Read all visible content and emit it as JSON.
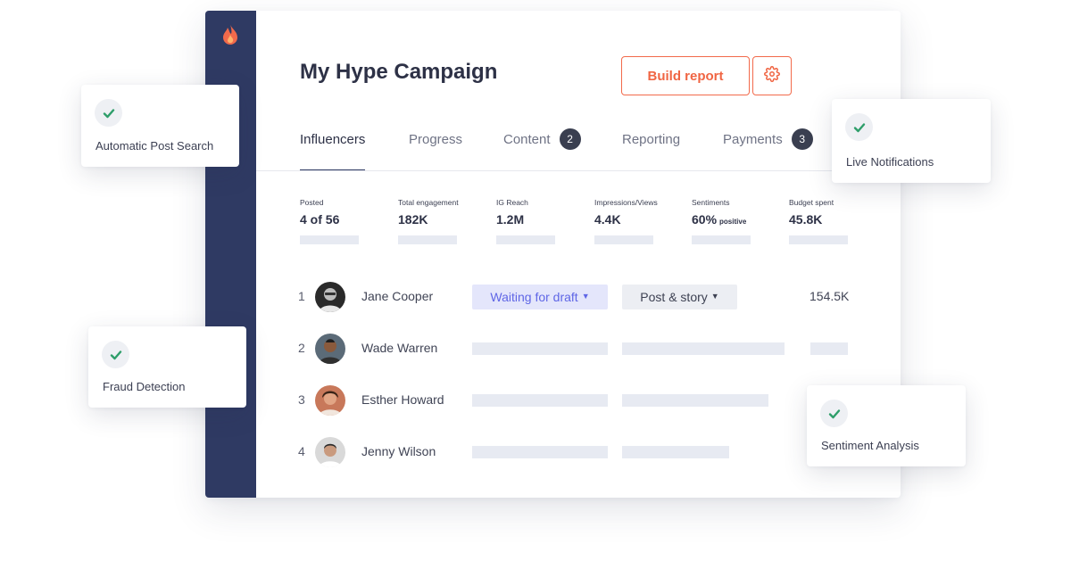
{
  "campaign": {
    "title": "My Hype Campaign"
  },
  "header": {
    "build_report_label": "Build report"
  },
  "tabs": [
    {
      "label": "Influencers",
      "badge": null,
      "active": true
    },
    {
      "label": "Progress",
      "badge": null,
      "active": false
    },
    {
      "label": "Content",
      "badge": "2",
      "active": false
    },
    {
      "label": "Reporting",
      "badge": null,
      "active": false
    },
    {
      "label": "Payments",
      "badge": "3",
      "active": false
    }
  ],
  "stats": [
    {
      "label": "Posted",
      "value": "4 of 56",
      "suffix": ""
    },
    {
      "label": "Total engagement",
      "value": "182K",
      "suffix": ""
    },
    {
      "label": "IG Reach",
      "value": "1.2M",
      "suffix": ""
    },
    {
      "label": "Impressions/Views",
      "value": "4.4K",
      "suffix": ""
    },
    {
      "label": "Sentiments",
      "value": "60%",
      "suffix": "positive"
    },
    {
      "label": "Budget spent",
      "value": "45.8K",
      "suffix": ""
    }
  ],
  "influencers": [
    {
      "rank": "1",
      "name": "Jane Cooper",
      "status": "Waiting for draft",
      "type": "Post & story",
      "reach": "154.5K"
    },
    {
      "rank": "2",
      "name": "Wade Warren"
    },
    {
      "rank": "3",
      "name": "Esther Howard"
    },
    {
      "rank": "4",
      "name": "Jenny Wilson"
    }
  ],
  "feature_cards": [
    {
      "label": "Automatic Post Search"
    },
    {
      "label": "Live Notifications"
    },
    {
      "label": "Fraud Detection"
    },
    {
      "label": "Sentiment Analysis"
    }
  ],
  "colors": {
    "sidebar": "#2f3a63",
    "accent": "#f06543",
    "status_text": "#5f66e6",
    "status_bg": "#e4e6fb",
    "check": "#2e9e6a"
  }
}
